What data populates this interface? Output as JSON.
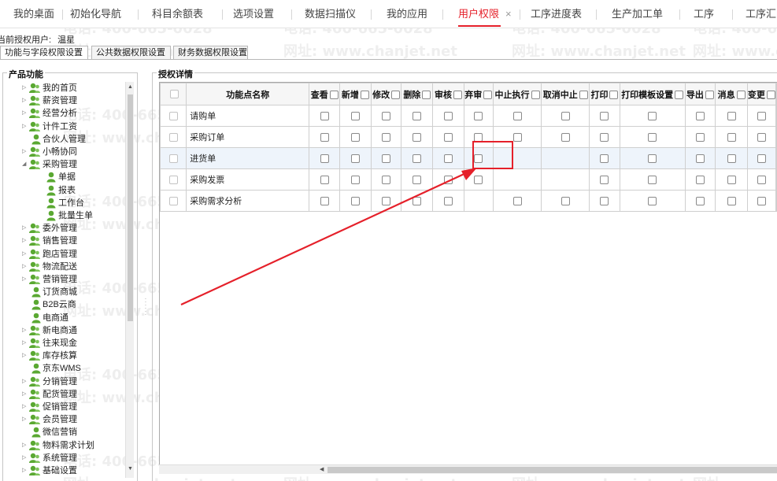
{
  "top_tabs": [
    {
      "label": "我的桌面",
      "active": false
    },
    {
      "label": "初始化导航",
      "active": false
    },
    {
      "label": "科目余额表",
      "active": false
    },
    {
      "label": "选项设置",
      "active": false
    },
    {
      "label": "数据扫描仪",
      "active": false
    },
    {
      "label": "我的应用",
      "active": false
    },
    {
      "label": "用户权限",
      "active": true
    },
    {
      "label": "工序进度表",
      "active": false
    },
    {
      "label": "生产加工单",
      "active": false
    },
    {
      "label": "工序",
      "active": false
    },
    {
      "label": "工序汇",
      "active": false
    }
  ],
  "close_icon": "×",
  "current_user": {
    "label": "当前授权用户:",
    "name": "温星"
  },
  "sub_tabs": [
    {
      "label": "功能与字段权限设置",
      "active": true
    },
    {
      "label": "公共数据权限设置",
      "active": false
    },
    {
      "label": "财务数据权限设置",
      "active": false
    }
  ],
  "product_panel": {
    "title": "产品功能"
  },
  "tree": [
    {
      "label": "我的首页",
      "level": 0,
      "expandable": true,
      "expanded": false
    },
    {
      "label": "薪资管理",
      "level": 0,
      "expandable": true,
      "expanded": false
    },
    {
      "label": "经营分析",
      "level": 0,
      "expandable": true,
      "expanded": false
    },
    {
      "label": "计件工资",
      "level": 0,
      "expandable": true,
      "expanded": false
    },
    {
      "label": "合伙人管理",
      "level": 0,
      "expandable": false,
      "expanded": false
    },
    {
      "label": "小畅协同",
      "level": 0,
      "expandable": true,
      "expanded": false
    },
    {
      "label": "采购管理",
      "level": 0,
      "expandable": true,
      "expanded": true
    },
    {
      "label": "单据",
      "level": 1,
      "expandable": false,
      "expanded": false
    },
    {
      "label": "报表",
      "level": 1,
      "expandable": false,
      "expanded": false
    },
    {
      "label": "工作台",
      "level": 1,
      "expandable": false,
      "expanded": false
    },
    {
      "label": "批量生单",
      "level": 1,
      "expandable": false,
      "expanded": false
    },
    {
      "label": "委外管理",
      "level": 0,
      "expandable": true,
      "expanded": false
    },
    {
      "label": "销售管理",
      "level": 0,
      "expandable": true,
      "expanded": false
    },
    {
      "label": "跑店管理",
      "level": 0,
      "expandable": true,
      "expanded": false
    },
    {
      "label": "物流配送",
      "level": 0,
      "expandable": true,
      "expanded": false
    },
    {
      "label": "营销管理",
      "level": 0,
      "expandable": true,
      "expanded": false
    },
    {
      "label": "订货商城",
      "level": 0,
      "expandable": false,
      "expanded": false
    },
    {
      "label": "B2B云商",
      "level": 0,
      "expandable": false,
      "expanded": false
    },
    {
      "label": "电商通",
      "level": 0,
      "expandable": false,
      "expanded": false
    },
    {
      "label": "新电商通",
      "level": 0,
      "expandable": true,
      "expanded": false
    },
    {
      "label": "往来现金",
      "level": 0,
      "expandable": true,
      "expanded": false
    },
    {
      "label": "库存核算",
      "level": 0,
      "expandable": true,
      "expanded": false
    },
    {
      "label": "京东WMS",
      "level": 0,
      "expandable": false,
      "expanded": false
    },
    {
      "label": "分销管理",
      "level": 0,
      "expandable": true,
      "expanded": false
    },
    {
      "label": "配货管理",
      "level": 0,
      "expandable": true,
      "expanded": false
    },
    {
      "label": "促销管理",
      "level": 0,
      "expandable": true,
      "expanded": false
    },
    {
      "label": "会员管理",
      "level": 0,
      "expandable": true,
      "expanded": false
    },
    {
      "label": "微信营销",
      "level": 0,
      "expandable": false,
      "expanded": false
    },
    {
      "label": "物料需求计划",
      "level": 0,
      "expandable": true,
      "expanded": false
    },
    {
      "label": "系统管理",
      "level": 0,
      "expandable": true,
      "expanded": false
    },
    {
      "label": "基础设置",
      "level": 0,
      "expandable": true,
      "expanded": false
    }
  ],
  "auth_panel": {
    "title": "授权详情"
  },
  "grid": {
    "name_header": "功能点名称",
    "columns": [
      "查看",
      "新增",
      "修改",
      "删除",
      "审核",
      "弃审",
      "中止执行",
      "取消中止",
      "打印",
      "打印模板设置",
      "导出",
      "消息",
      "变更"
    ],
    "rows": [
      {
        "name": "请购单",
        "cells": [
          true,
          true,
          true,
          true,
          true,
          true,
          true,
          true,
          true,
          true,
          true,
          true,
          true
        ],
        "highlighted": false
      },
      {
        "name": "采购订单",
        "cells": [
          true,
          true,
          true,
          true,
          true,
          true,
          true,
          true,
          true,
          true,
          true,
          true,
          true
        ],
        "highlighted": false
      },
      {
        "name": "进货单",
        "cells": [
          true,
          true,
          true,
          true,
          true,
          true,
          false,
          false,
          true,
          true,
          true,
          true,
          true
        ],
        "highlighted": true
      },
      {
        "name": "采购发票",
        "cells": [
          true,
          true,
          true,
          true,
          true,
          true,
          false,
          false,
          true,
          true,
          true,
          true,
          true
        ],
        "highlighted": false
      },
      {
        "name": "采购需求分析",
        "cells": [
          true,
          true,
          true,
          true,
          true,
          false,
          true,
          true,
          true,
          true,
          true,
          true,
          true
        ],
        "highlighted": false
      }
    ]
  },
  "watermark": {
    "phone": "电话: 400-665-0028",
    "site": "网址: www.chanjet.net"
  },
  "colors": {
    "accent": "#e5202a",
    "row_highlight": "#eef4fb",
    "user_icon": "#5aa832"
  },
  "icons": {
    "scroll_up": "▲",
    "scroll_down": "▼",
    "scroll_left": "◀",
    "collapsed": "▷",
    "expanded": "◢"
  }
}
